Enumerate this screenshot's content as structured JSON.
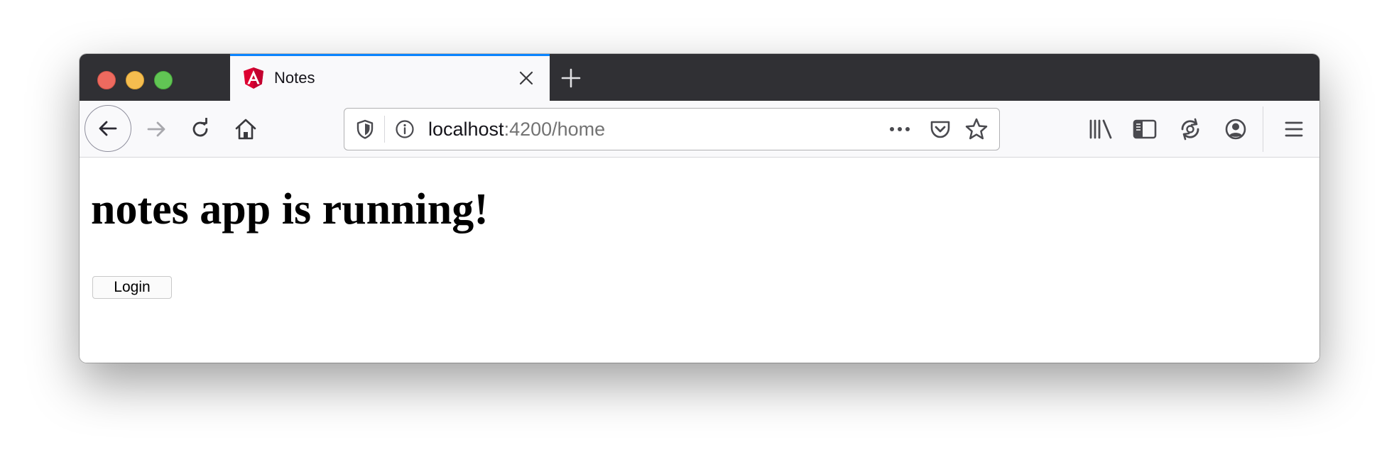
{
  "browser": {
    "tab": {
      "title": "Notes",
      "favicon": "angular-logo-icon"
    },
    "url": {
      "host": "localhost",
      "path": ":4200/home"
    },
    "accent_color": "#0a84ff",
    "icons": [
      "back-arrow-icon",
      "forward-arrow-icon",
      "reload-icon",
      "home-icon",
      "tracking-shield-icon",
      "info-icon",
      "more-dots-icon",
      "pocket-icon",
      "bookmark-star-icon",
      "library-icon",
      "sidebar-icon",
      "sync-icon",
      "account-icon",
      "hamburger-menu-icon"
    ]
  },
  "page": {
    "heading": "notes app is running!",
    "login_label": "Login"
  },
  "colors": {
    "traffic_close": "#ee6a5f",
    "traffic_minimize": "#f5bd4f",
    "traffic_maximize": "#61c554",
    "angular_red": "#dd0031"
  }
}
